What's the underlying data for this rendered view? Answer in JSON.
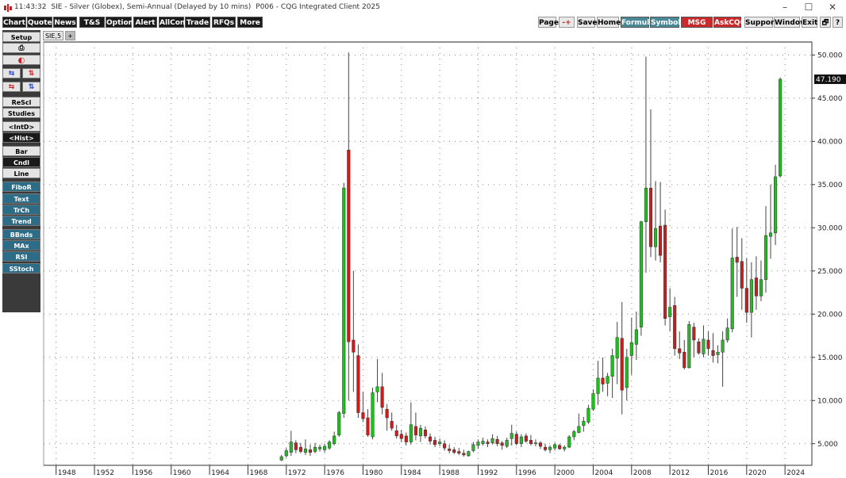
{
  "window": {
    "time": "11:43:32",
    "title": "SIE - Silver (Globex), Semi-Annual (Delayed by 10 mins)",
    "page_info": "P006 - CQG Integrated Client 2025",
    "minimize_glyph": "–",
    "maximize_glyph": "☐",
    "close_glyph": "✕"
  },
  "menu": {
    "left": [
      "Chart",
      "Quote",
      "News",
      "T&S",
      "Options",
      "Alert",
      "AllCon",
      "Trade",
      "RFQs",
      "More"
    ],
    "right": [
      "Page",
      "-+",
      "Save",
      "Home",
      "Formula",
      "Symbols",
      "MSG Cntr",
      "AskCQG",
      "Support",
      "Window",
      "Exit",
      "🗗",
      "?"
    ]
  },
  "sidebar": {
    "setup": "Setup",
    "print_icon": "⎙",
    "icon_row2": "◐",
    "pair1": [
      "⇆",
      "⇅"
    ],
    "pair2": [
      "⇆",
      "⇅"
    ],
    "buttons": [
      "ReScl",
      "Studies",
      "<IntD>",
      "<Hist>",
      "Bar",
      "Cndl",
      "Line",
      "FiboR",
      "Text",
      "TrCh",
      "Trend",
      "BBnds",
      "MAx",
      "RSI",
      "SStoch"
    ]
  },
  "tabs": {
    "symbol": "SIE,5",
    "add": "+"
  },
  "colors": {
    "up": "#22bb22",
    "down": "#c42020",
    "wick": "#444444",
    "last_price_box": "#111111",
    "grid": "#888888"
  },
  "chart_data": {
    "type": "candlestick",
    "ylim": [
      2.5,
      51.5
    ],
    "ytick_values": [
      5,
      10,
      15,
      20,
      25,
      30,
      35,
      40,
      45,
      50
    ],
    "ytick_labels": [
      "5.000",
      "10.000",
      "15.000",
      "20.000",
      "25.000",
      "30.000",
      "35.000",
      "40.000",
      "45.000",
      "50.000"
    ],
    "xlim": [
      1946.7,
      2026.8
    ],
    "xtick_labels": [
      "1948",
      "1952",
      "1956",
      "1960",
      "1964",
      "1968",
      "1972",
      "1976",
      "1980",
      "1984",
      "1988",
      "1992",
      "1996",
      "2000",
      "2004",
      "2008",
      "2012",
      "2016",
      "2020",
      "2024"
    ],
    "last_price": "47.190",
    "last_value": 47.19,
    "candles": [
      {
        "t": 1971.5,
        "o": 3.1,
        "h": 3.7,
        "l": 3.0,
        "c": 3.5
      },
      {
        "t": 1972.0,
        "o": 3.6,
        "h": 4.5,
        "l": 3.4,
        "c": 4.2
      },
      {
        "t": 1972.5,
        "o": 4.0,
        "h": 6.5,
        "l": 3.6,
        "c": 5.2
      },
      {
        "t": 1973.0,
        "o": 5.1,
        "h": 5.4,
        "l": 3.9,
        "c": 4.3
      },
      {
        "t": 1973.5,
        "o": 4.6,
        "h": 5.1,
        "l": 3.9,
        "c": 4.1
      },
      {
        "t": 1974.0,
        "o": 4.0,
        "h": 5.5,
        "l": 3.7,
        "c": 4.4
      },
      {
        "t": 1974.5,
        "o": 4.3,
        "h": 4.9,
        "l": 3.6,
        "c": 4.0
      },
      {
        "t": 1975.0,
        "o": 4.1,
        "h": 5.1,
        "l": 3.9,
        "c": 4.6
      },
      {
        "t": 1975.5,
        "o": 4.4,
        "h": 4.9,
        "l": 4.1,
        "c": 4.6
      },
      {
        "t": 1976.0,
        "o": 4.3,
        "h": 5.0,
        "l": 4.0,
        "c": 4.7
      },
      {
        "t": 1976.5,
        "o": 4.5,
        "h": 5.4,
        "l": 4.3,
        "c": 5.2
      },
      {
        "t": 1977.0,
        "o": 5.0,
        "h": 6.4,
        "l": 4.8,
        "c": 5.9
      },
      {
        "t": 1977.5,
        "o": 6.0,
        "h": 8.8,
        "l": 5.8,
        "c": 8.6
      },
      {
        "t": 1978.0,
        "o": 8.5,
        "h": 35.2,
        "l": 8.0,
        "c": 34.6
      },
      {
        "t": 1978.5,
        "o": 39.0,
        "h": 50.3,
        "l": 10.0,
        "c": 16.8
      },
      {
        "t": 1979.0,
        "o": 17.0,
        "h": 25.0,
        "l": 11.0,
        "c": 15.6
      },
      {
        "t": 1979.5,
        "o": 15.2,
        "h": 16.5,
        "l": 8.0,
        "c": 8.6
      },
      {
        "t": 1980.0,
        "o": 8.6,
        "h": 11.0,
        "l": 7.5,
        "c": 7.9
      },
      {
        "t": 1980.5,
        "o": 8.0,
        "h": 9.0,
        "l": 5.8,
        "c": 6.0
      },
      {
        "t": 1981.0,
        "o": 5.8,
        "h": 11.5,
        "l": 5.5,
        "c": 10.9
      },
      {
        "t": 1981.5,
        "o": 11.0,
        "h": 14.8,
        "l": 9.8,
        "c": 11.6
      },
      {
        "t": 1982.0,
        "o": 11.6,
        "h": 13.2,
        "l": 8.4,
        "c": 9.2
      },
      {
        "t": 1982.5,
        "o": 9.0,
        "h": 9.6,
        "l": 6.5,
        "c": 8.0
      },
      {
        "t": 1983.0,
        "o": 7.6,
        "h": 8.6,
        "l": 6.5,
        "c": 6.8
      },
      {
        "t": 1983.5,
        "o": 6.5,
        "h": 7.2,
        "l": 5.6,
        "c": 5.9
      },
      {
        "t": 1984.0,
        "o": 6.1,
        "h": 6.6,
        "l": 5.2,
        "c": 5.6
      },
      {
        "t": 1984.5,
        "o": 5.9,
        "h": 6.3,
        "l": 4.8,
        "c": 5.2
      },
      {
        "t": 1985.0,
        "o": 5.2,
        "h": 9.8,
        "l": 4.9,
        "c": 7.2
      },
      {
        "t": 1985.5,
        "o": 7.0,
        "h": 8.6,
        "l": 5.4,
        "c": 6.0
      },
      {
        "t": 1986.0,
        "o": 5.9,
        "h": 7.2,
        "l": 5.2,
        "c": 6.8
      },
      {
        "t": 1986.5,
        "o": 6.6,
        "h": 7.0,
        "l": 5.6,
        "c": 5.9
      },
      {
        "t": 1987.0,
        "o": 5.8,
        "h": 6.2,
        "l": 4.9,
        "c": 5.3
      },
      {
        "t": 1987.5,
        "o": 5.4,
        "h": 5.8,
        "l": 4.6,
        "c": 4.9
      },
      {
        "t": 1988.0,
        "o": 5.0,
        "h": 5.6,
        "l": 4.7,
        "c": 5.2
      },
      {
        "t": 1988.5,
        "o": 5.0,
        "h": 5.4,
        "l": 4.2,
        "c": 4.5
      },
      {
        "t": 1989.0,
        "o": 4.4,
        "h": 4.9,
        "l": 3.9,
        "c": 4.2
      },
      {
        "t": 1989.5,
        "o": 4.3,
        "h": 4.6,
        "l": 3.8,
        "c": 4.0
      },
      {
        "t": 1990.0,
        "o": 4.1,
        "h": 4.5,
        "l": 3.7,
        "c": 3.9
      },
      {
        "t": 1990.5,
        "o": 3.9,
        "h": 4.3,
        "l": 3.5,
        "c": 3.7
      },
      {
        "t": 1991.0,
        "o": 3.6,
        "h": 4.2,
        "l": 3.5,
        "c": 4.1
      },
      {
        "t": 1991.5,
        "o": 4.2,
        "h": 5.2,
        "l": 4.0,
        "c": 4.9
      },
      {
        "t": 1992.0,
        "o": 4.8,
        "h": 5.5,
        "l": 4.4,
        "c": 5.2
      },
      {
        "t": 1992.5,
        "o": 5.0,
        "h": 5.7,
        "l": 4.8,
        "c": 5.3
      },
      {
        "t": 1993.0,
        "o": 5.2,
        "h": 5.5,
        "l": 4.6,
        "c": 5.0
      },
      {
        "t": 1993.5,
        "o": 5.1,
        "h": 6.1,
        "l": 4.9,
        "c": 5.6
      },
      {
        "t": 1994.0,
        "o": 5.5,
        "h": 5.9,
        "l": 4.7,
        "c": 5.0
      },
      {
        "t": 1994.5,
        "o": 5.1,
        "h": 5.3,
        "l": 4.3,
        "c": 4.8
      },
      {
        "t": 1995.0,
        "o": 4.7,
        "h": 5.7,
        "l": 4.5,
        "c": 5.4
      },
      {
        "t": 1995.5,
        "o": 5.6,
        "h": 7.2,
        "l": 4.8,
        "c": 6.2
      },
      {
        "t": 1996.0,
        "o": 6.1,
        "h": 6.4,
        "l": 4.8,
        "c": 5.0
      },
      {
        "t": 1996.5,
        "o": 5.0,
        "h": 6.1,
        "l": 4.6,
        "c": 5.8
      },
      {
        "t": 1997.0,
        "o": 5.9,
        "h": 6.2,
        "l": 5.1,
        "c": 5.3
      },
      {
        "t": 1997.5,
        "o": 5.4,
        "h": 6.0,
        "l": 4.8,
        "c": 5.0
      },
      {
        "t": 1998.0,
        "o": 5.0,
        "h": 5.5,
        "l": 4.7,
        "c": 5.1
      },
      {
        "t": 1998.5,
        "o": 5.1,
        "h": 5.3,
        "l": 4.4,
        "c": 4.7
      },
      {
        "t": 1999.0,
        "o": 4.6,
        "h": 5.0,
        "l": 4.1,
        "c": 4.3
      },
      {
        "t": 1999.5,
        "o": 4.3,
        "h": 4.8,
        "l": 3.9,
        "c": 4.6
      },
      {
        "t": 2000.0,
        "o": 4.5,
        "h": 5.1,
        "l": 4.2,
        "c": 4.9
      },
      {
        "t": 2000.5,
        "o": 4.8,
        "h": 5.0,
        "l": 4.3,
        "c": 4.4
      },
      {
        "t": 2001.0,
        "o": 4.4,
        "h": 4.8,
        "l": 4.1,
        "c": 4.6
      },
      {
        "t": 2001.5,
        "o": 4.6,
        "h": 6.0,
        "l": 4.5,
        "c": 5.8
      },
      {
        "t": 2002.0,
        "o": 5.8,
        "h": 6.6,
        "l": 5.4,
        "c": 6.4
      },
      {
        "t": 2002.5,
        "o": 6.3,
        "h": 8.5,
        "l": 6.2,
        "c": 7.0
      },
      {
        "t": 2003.0,
        "o": 7.1,
        "h": 8.1,
        "l": 6.4,
        "c": 7.6
      },
      {
        "t": 2003.5,
        "o": 7.5,
        "h": 9.5,
        "l": 7.3,
        "c": 9.1
      },
      {
        "t": 2004.0,
        "o": 9.0,
        "h": 11.3,
        "l": 8.8,
        "c": 10.8
      },
      {
        "t": 2004.5,
        "o": 10.8,
        "h": 14.6,
        "l": 9.5,
        "c": 12.6
      },
      {
        "t": 2005.0,
        "o": 12.6,
        "h": 15.0,
        "l": 11.0,
        "c": 11.9
      },
      {
        "t": 2005.5,
        "o": 12.0,
        "h": 13.2,
        "l": 10.5,
        "c": 12.8
      },
      {
        "t": 2006.0,
        "o": 12.8,
        "h": 16.0,
        "l": 10.3,
        "c": 15.2
      },
      {
        "t": 2006.5,
        "o": 14.9,
        "h": 19.1,
        "l": 11.9,
        "c": 17.3
      },
      {
        "t": 2007.0,
        "o": 17.2,
        "h": 21.4,
        "l": 8.4,
        "c": 11.2
      },
      {
        "t": 2007.5,
        "o": 11.5,
        "h": 16.0,
        "l": 10.0,
        "c": 15.0
      },
      {
        "t": 2008.0,
        "o": 15.2,
        "h": 19.6,
        "l": 13.0,
        "c": 16.7
      },
      {
        "t": 2008.5,
        "o": 16.5,
        "h": 20.3,
        "l": 14.7,
        "c": 18.2
      },
      {
        "t": 2009.0,
        "o": 18.5,
        "h": 30.8,
        "l": 17.5,
        "c": 30.7
      },
      {
        "t": 2009.5,
        "o": 30.7,
        "h": 49.8,
        "l": 24.8,
        "c": 34.6
      },
      {
        "t": 2010.0,
        "o": 34.6,
        "h": 43.7,
        "l": 26.6,
        "c": 27.8
      },
      {
        "t": 2010.5,
        "o": 27.8,
        "h": 35.4,
        "l": 26.2,
        "c": 29.9
      },
      {
        "t": 2011.0,
        "o": 30.2,
        "h": 35.3,
        "l": 26.0,
        "c": 26.8
      },
      {
        "t": 2011.5,
        "o": 30.3,
        "h": 32.1,
        "l": 18.7,
        "c": 19.5
      },
      {
        "t": 2012.0,
        "o": 19.7,
        "h": 23.0,
        "l": 18.0,
        "c": 20.8
      },
      {
        "t": 2012.5,
        "o": 21.0,
        "h": 22.0,
        "l": 15.2,
        "c": 16.0
      },
      {
        "t": 2013.0,
        "o": 16.0,
        "h": 18.0,
        "l": 14.8,
        "c": 15.5
      },
      {
        "t": 2013.5,
        "o": 15.6,
        "h": 17.0,
        "l": 13.6,
        "c": 13.8
      },
      {
        "t": 2014.0,
        "o": 13.8,
        "h": 19.2,
        "l": 13.7,
        "c": 18.8
      },
      {
        "t": 2014.5,
        "o": 18.5,
        "h": 19.0,
        "l": 15.0,
        "c": 17.0
      },
      {
        "t": 2015.0,
        "o": 16.8,
        "h": 17.2,
        "l": 15.3,
        "c": 15.5
      },
      {
        "t": 2015.5,
        "o": 15.4,
        "h": 18.7,
        "l": 15.0,
        "c": 17.1
      },
      {
        "t": 2016.0,
        "o": 17.0,
        "h": 18.0,
        "l": 15.2,
        "c": 16.0
      },
      {
        "t": 2016.5,
        "o": 15.8,
        "h": 17.8,
        "l": 14.4,
        "c": 15.2
      },
      {
        "t": 2017.0,
        "o": 15.3,
        "h": 16.4,
        "l": 14.3,
        "c": 15.6
      },
      {
        "t": 2017.5,
        "o": 15.6,
        "h": 18.0,
        "l": 11.6,
        "c": 17.0
      },
      {
        "t": 2018.0,
        "o": 17.0,
        "h": 19.5,
        "l": 16.7,
        "c": 18.4
      },
      {
        "t": 2018.5,
        "o": 18.3,
        "h": 29.9,
        "l": 17.9,
        "c": 26.5
      },
      {
        "t": 2019.0,
        "o": 26.6,
        "h": 30.1,
        "l": 22.0,
        "c": 26.0
      },
      {
        "t": 2019.5,
        "o": 26.1,
        "h": 28.8,
        "l": 20.5,
        "c": 23.0
      },
      {
        "t": 2020.0,
        "o": 23.0,
        "h": 26.5,
        "l": 19.0,
        "c": 20.2
      },
      {
        "t": 2020.5,
        "o": 20.2,
        "h": 26.0,
        "l": 17.3,
        "c": 24.0
      },
      {
        "t": 2021.0,
        "o": 24.2,
        "h": 26.7,
        "l": 20.5,
        "c": 22.1
      },
      {
        "t": 2021.5,
        "o": 22.1,
        "h": 26.2,
        "l": 21.5,
        "c": 24.0
      },
      {
        "t": 2022.0,
        "o": 24.0,
        "h": 32.5,
        "l": 22.5,
        "c": 29.1
      },
      {
        "t": 2022.5,
        "o": 29.0,
        "h": 35.0,
        "l": 26.4,
        "c": 29.4
      },
      {
        "t": 2023.0,
        "o": 29.4,
        "h": 37.3,
        "l": 28.0,
        "c": 35.9
      },
      {
        "t": 2023.5,
        "o": 36.0,
        "h": 47.4,
        "l": 35.8,
        "c": 47.19
      }
    ]
  }
}
